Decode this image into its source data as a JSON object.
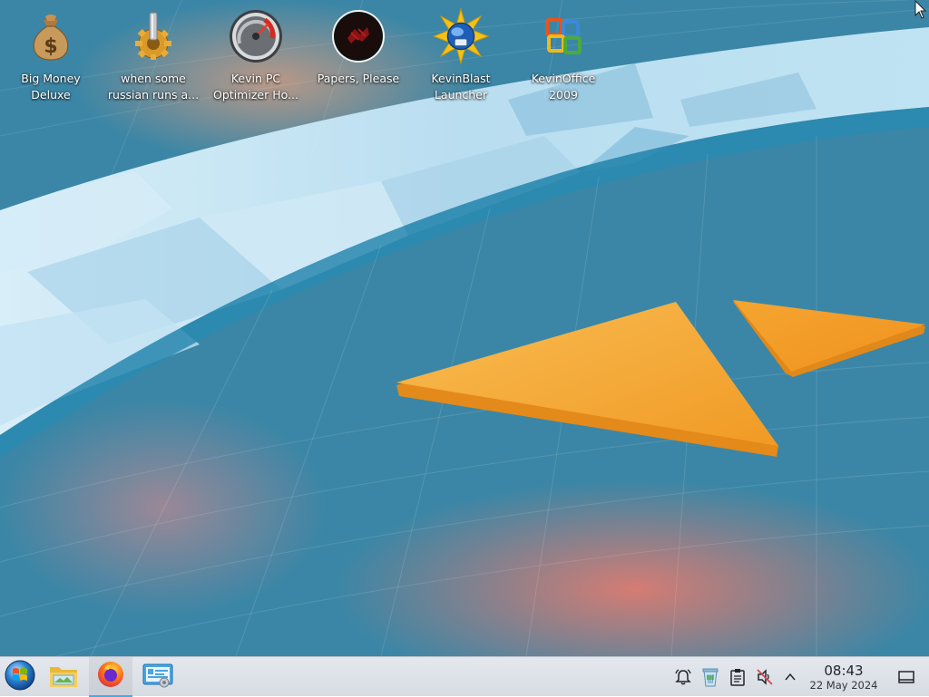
{
  "desktop": {
    "icons": [
      {
        "label": "Big Money\nDeluxe",
        "icon": "money-bag-icon"
      },
      {
        "label": "when some\nrussian runs a...",
        "icon": "gear-icon"
      },
      {
        "label": "Kevin PC\nOptimizer Ho...",
        "icon": "speedometer-icon"
      },
      {
        "label": "Papers, Please",
        "icon": "papers-please-icon"
      },
      {
        "label": "KevinBlast\nLauncher",
        "icon": "kevinblast-icon"
      },
      {
        "label": "KevinOffice\n2009",
        "icon": "office-icon"
      }
    ]
  },
  "taskbar": {
    "start_icon": "start-orb-icon",
    "pinned": [
      "file-manager-icon",
      "firefox-icon",
      "system-settings-icon"
    ],
    "tray": [
      "notifications-icon",
      "trash-icon",
      "clipboard-icon",
      "volume-muted-icon",
      "expand-tray-icon"
    ],
    "clock": {
      "time": "08:43",
      "date": "22 May 2024"
    },
    "show_desktop_icon": "show-desktop-icon"
  },
  "colors": {
    "accent": "#3daee9",
    "taskbar_bg": "#dde1e7",
    "wallpaper_orange": "#f5a531"
  }
}
